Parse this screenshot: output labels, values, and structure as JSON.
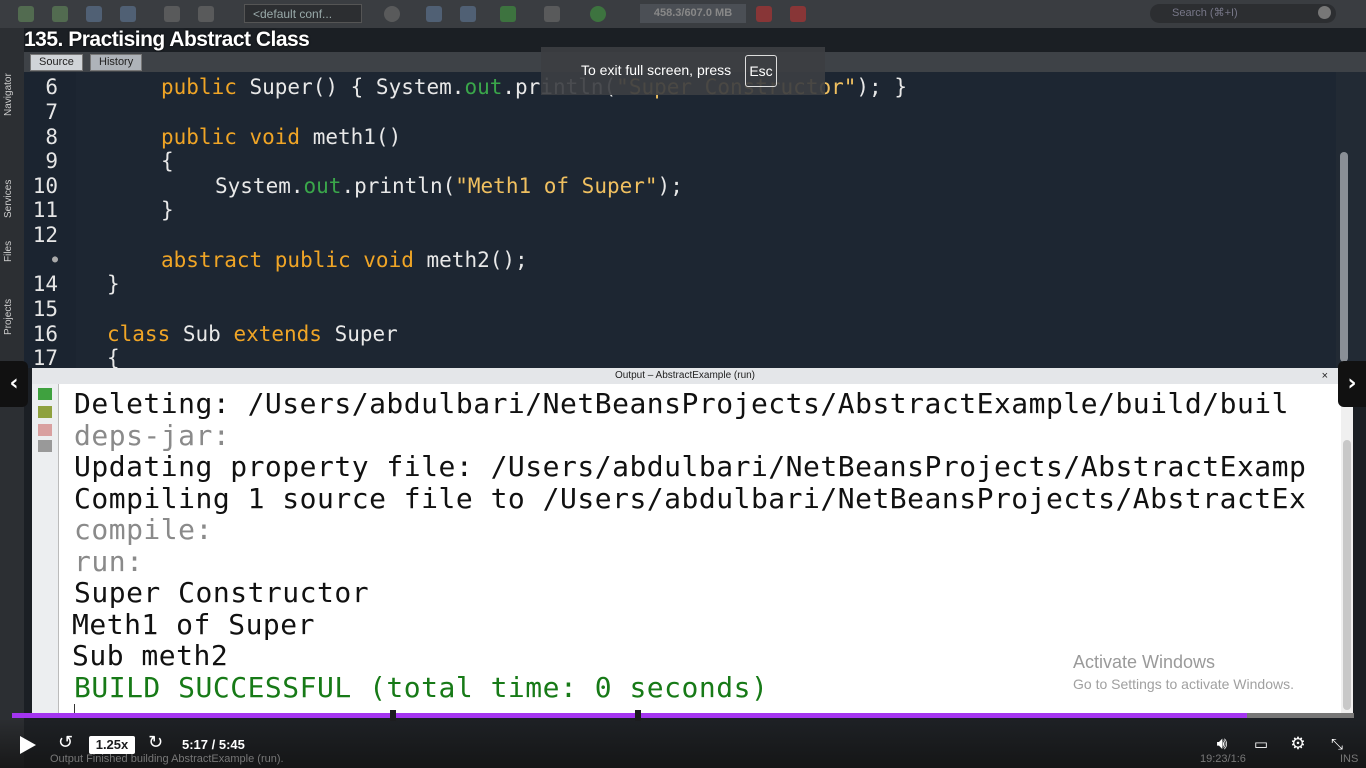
{
  "ide": {
    "config": "<default conf...",
    "memory": "458.3/607.0 MB",
    "search_placeholder": "Search (⌘+I)",
    "editor_tabs": [
      "Source",
      "History"
    ],
    "side_tabs": [
      "Navigator",
      "Services",
      "Files",
      "Projects"
    ]
  },
  "video": {
    "title": "135. Practising Abstract Class"
  },
  "fullscreen_banner": {
    "text": "To exit full screen, press",
    "key": "Esc"
  },
  "editor": {
    "line_numbers": [
      "6",
      "7",
      "8",
      "9",
      "10",
      "11",
      "12",
      "",
      "14",
      "15",
      "16",
      "17"
    ]
  },
  "output": {
    "header": "Output – AbstractExample (run)",
    "close": "×",
    "lines": [
      "Deleting: /Users/abdulbari/NetBeansProjects/AbstractExample/build/buil",
      "deps-jar:",
      "Updating property file: /Users/abdulbari/NetBeansProjects/AbstractExamp",
      "Compiling 1 source file to /Users/abdulbari/NetBeansProjects/AbstractEx",
      "compile:",
      "run:",
      "Super Constructor",
      "Meth1 of Super",
      "Sub meth2",
      "BUILD SUCCESSFUL (total time: 0 seconds)"
    ]
  },
  "watermark": {
    "title": "Activate Windows",
    "subtitle": "Go to Settings to activate Windows."
  },
  "player": {
    "speed": "1.25x",
    "time": "5:17 / 5:45",
    "progress": 0.92,
    "status_ghost": "Output    Finished building AbstractExample (run).",
    "cursor_pos": "19:23/1:6",
    "ins": "INS"
  },
  "colors": {
    "keyword": "#f0a526",
    "string": "#f0c060",
    "field": "#3aa64a",
    "build_success": "#177a17",
    "progress": "#a435f0"
  }
}
